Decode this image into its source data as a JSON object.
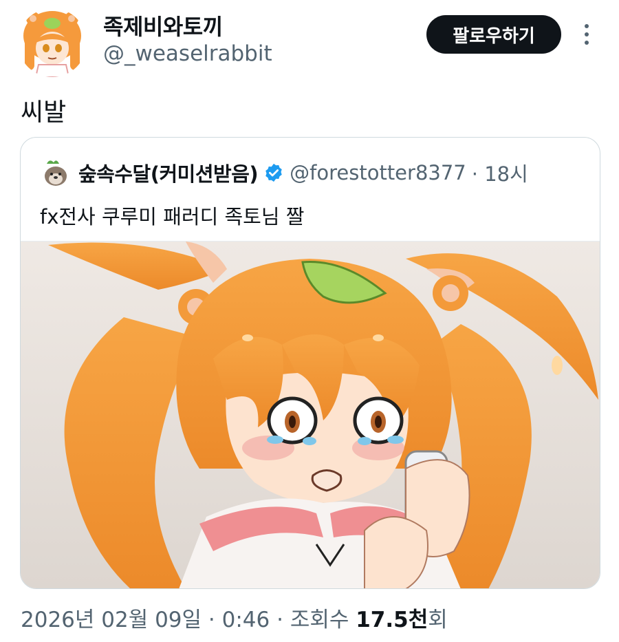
{
  "author": {
    "display_name": "족제비와토끼",
    "handle": "@_weaselrabbit",
    "avatar_icon": "anime-girl-avatar-icon"
  },
  "follow_label": "팔로우하기",
  "more_icon": "more-vertical-icon",
  "tweet_text": "씨발",
  "quote": {
    "display_name": "숲속수달(커미션받음)",
    "handle": "@forestotter8377",
    "time": "· 18시",
    "verified_icon": "verified-badge-icon",
    "avatar_icon": "otter-avatar-icon",
    "text": "fx전사 쿠루미 패러디 족토님 짤",
    "media_icon": "anime-girl-crying-phone-illustration"
  },
  "meta": {
    "date": "2026년 02월 09일",
    "sep1": " · ",
    "time": "0:46",
    "sep2": " · ",
    "views_label": "조회수 ",
    "views_count": "17.5천",
    "views_suffix": "회"
  },
  "colors": {
    "text": "#0f1419",
    "secondary": "#536471",
    "verified": "#1d9bf0",
    "hair": "#f59a3c"
  }
}
